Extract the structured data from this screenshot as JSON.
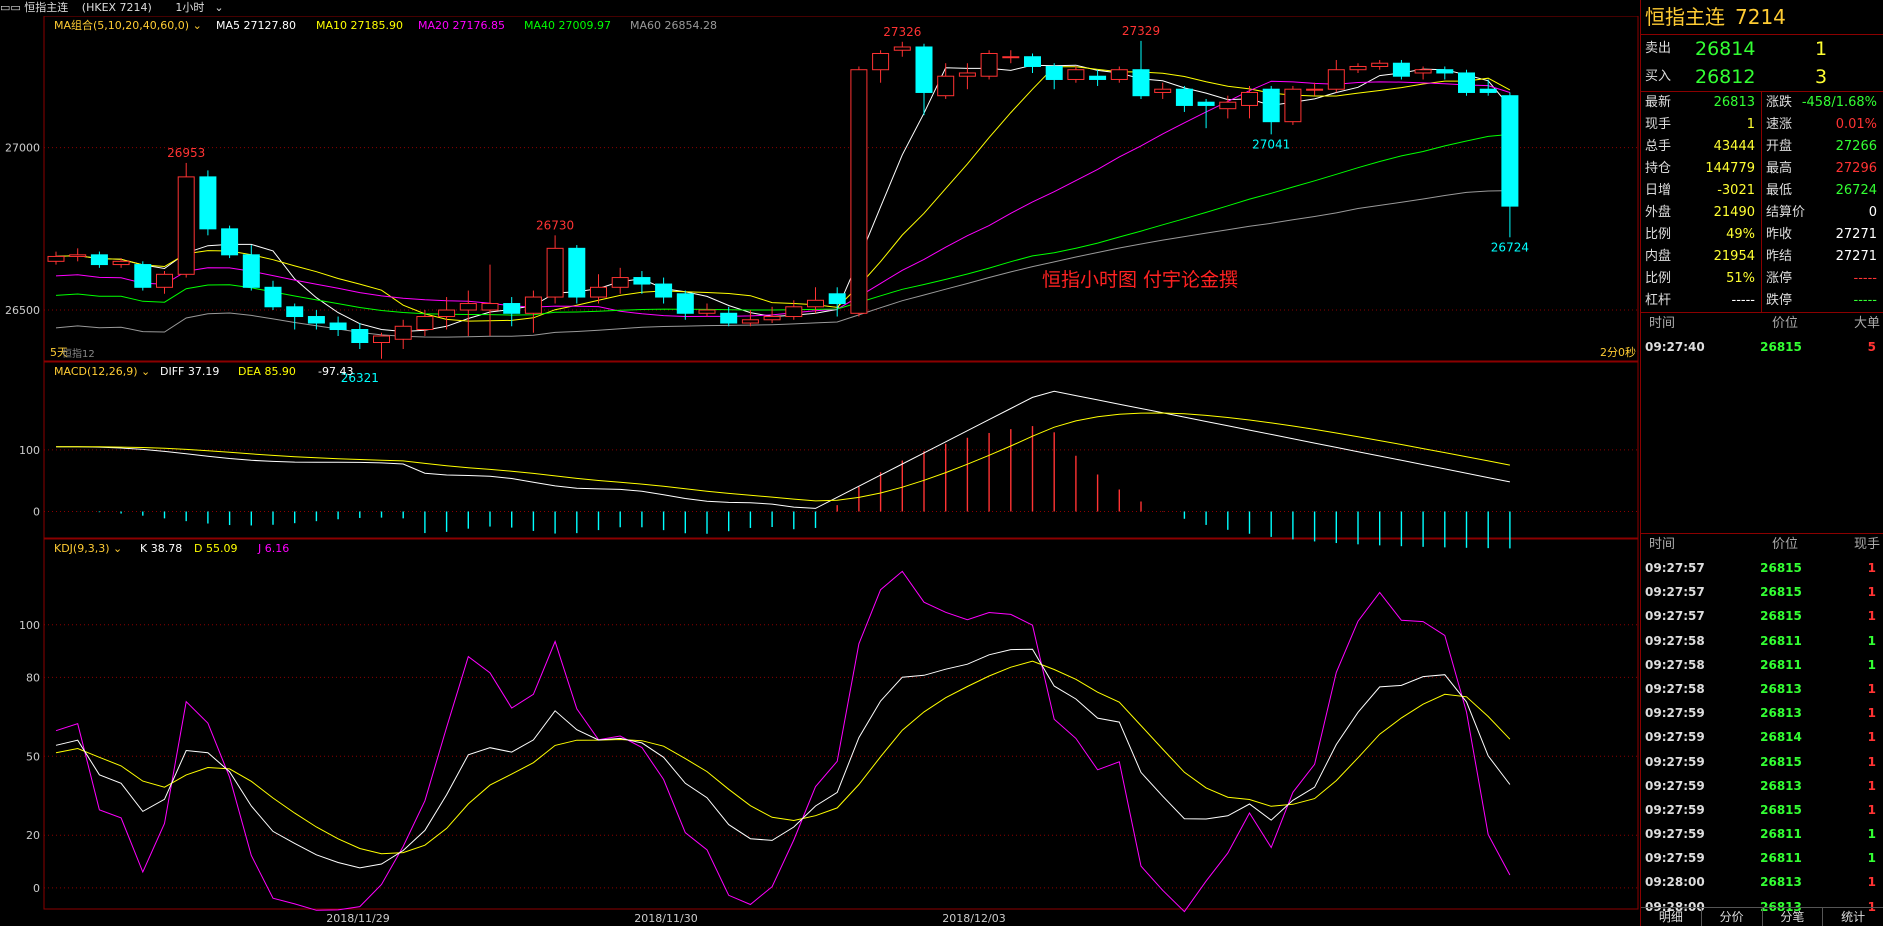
{
  "window": {
    "title": "恒指主连",
    "code": "(HKEX 7214)",
    "period": "1小时"
  },
  "panels": {
    "main": {
      "ma_label": "MA组合(5,10,20,40,60,0)",
      "ma_values": [
        {
          "label": "MA5 27127.80",
          "color": "#ffffff"
        },
        {
          "label": "MA10 27185.90",
          "color": "#ffff00"
        },
        {
          "label": "MA20 27176.85",
          "color": "#ff00ff"
        },
        {
          "label": "MA40 27009.97",
          "color": "#00ff00"
        },
        {
          "label": "MA60 26854.28",
          "color": "#999999"
        }
      ],
      "y_ticks": [
        "27000",
        "26500"
      ],
      "annotations": [
        "26953",
        "26730",
        "27326",
        "27329",
        "27041",
        "26724",
        "26321"
      ],
      "watermark": "恒指小时图  付宇论金撰",
      "left_corner": "5天",
      "left_corner2": "恒指12",
      "countdown": "2分0秒"
    },
    "macd": {
      "label": "MACD(12,26,9)",
      "diff": "DIFF 37.19",
      "dea": "DEA 85.90",
      "macd": "-97.43",
      "y_ticks": [
        "100",
        "0"
      ]
    },
    "kdj": {
      "label": "KDJ(9,3,3)",
      "k": "K 38.78",
      "d": "D 55.09",
      "j": "J 6.16",
      "y_ticks": [
        "100",
        "80",
        "50",
        "20",
        "0"
      ]
    },
    "x_dates": [
      "2018/11/29",
      "2018/11/30",
      "2018/12/03"
    ]
  },
  "chart_data": {
    "type": "candlestick",
    "candles": [
      [
        26650,
        26665,
        26640,
        26680
      ],
      [
        26665,
        26670,
        26650,
        26690
      ],
      [
        26670,
        26640,
        26630,
        26680
      ],
      [
        26640,
        26650,
        26630,
        26660
      ],
      [
        26640,
        26570,
        26560,
        26650
      ],
      [
        26570,
        26610,
        26550,
        26620
      ],
      [
        26610,
        26910,
        26600,
        26953
      ],
      [
        26910,
        26750,
        26730,
        26930
      ],
      [
        26750,
        26670,
        26660,
        26760
      ],
      [
        26670,
        26570,
        26560,
        26700
      ],
      [
        26570,
        26510,
        26500,
        26590
      ],
      [
        26510,
        26480,
        26440,
        26520
      ],
      [
        26480,
        26460,
        26440,
        26500
      ],
      [
        26460,
        26440,
        26420,
        26480
      ],
      [
        26440,
        26400,
        26380,
        26460
      ],
      [
        26400,
        26420,
        26350,
        26430
      ],
      [
        26410,
        26450,
        26380,
        26470
      ],
      [
        26440,
        26480,
        26420,
        26500
      ],
      [
        26480,
        26500,
        26440,
        26540
      ],
      [
        26500,
        26520,
        26420,
        26560
      ],
      [
        26500,
        26520,
        26420,
        26640
      ],
      [
        26520,
        26490,
        26450,
        26540
      ],
      [
        26490,
        26540,
        26430,
        26560
      ],
      [
        26540,
        26690,
        26520,
        26730
      ],
      [
        26690,
        26540,
        26520,
        26700
      ],
      [
        26540,
        26570,
        26520,
        26610
      ],
      [
        26570,
        26600,
        26550,
        26630
      ],
      [
        26600,
        26580,
        26550,
        26620
      ],
      [
        26580,
        26540,
        26520,
        26600
      ],
      [
        26550,
        26490,
        26470,
        26560
      ],
      [
        26490,
        26500,
        26480,
        26520
      ],
      [
        26490,
        26460,
        26450,
        26510
      ],
      [
        26460,
        26470,
        26450,
        26500
      ],
      [
        26470,
        26480,
        26460,
        26510
      ],
      [
        26480,
        26510,
        26470,
        26530
      ],
      [
        26510,
        26530,
        26490,
        26570
      ],
      [
        26550,
        26520,
        26480,
        26570
      ],
      [
        26490,
        27240,
        26480,
        27250
      ],
      [
        27240,
        27290,
        27200,
        27300
      ],
      [
        27300,
        27310,
        27280,
        27326
      ],
      [
        27310,
        27170,
        27100,
        27320
      ],
      [
        27160,
        27220,
        27150,
        27260
      ],
      [
        27220,
        27230,
        27180,
        27260
      ],
      [
        27220,
        27290,
        27210,
        27300
      ],
      [
        27280,
        27280,
        27260,
        27300
      ],
      [
        27280,
        27250,
        27230,
        27290
      ],
      [
        27250,
        27210,
        27180,
        27260
      ],
      [
        27210,
        27240,
        27200,
        27250
      ],
      [
        27220,
        27210,
        27190,
        27240
      ],
      [
        27210,
        27240,
        27200,
        27250
      ],
      [
        27240,
        27160,
        27150,
        27329
      ],
      [
        27170,
        27180,
        27150,
        27200
      ],
      [
        27180,
        27130,
        27110,
        27190
      ],
      [
        27140,
        27130,
        27060,
        27150
      ],
      [
        27120,
        27140,
        27090,
        27160
      ],
      [
        27130,
        27170,
        27090,
        27190
      ],
      [
        27180,
        27080,
        27041,
        27190
      ],
      [
        27080,
        27180,
        27070,
        27190
      ],
      [
        27180,
        27180,
        27160,
        27200
      ],
      [
        27180,
        27240,
        27170,
        27270
      ],
      [
        27240,
        27250,
        27230,
        27260
      ],
      [
        27250,
        27260,
        27240,
        27270
      ],
      [
        27260,
        27220,
        27210,
        27270
      ],
      [
        27230,
        27240,
        27210,
        27250
      ],
      [
        27240,
        27230,
        27210,
        27250
      ],
      [
        27230,
        27170,
        27160,
        27240
      ],
      [
        27180,
        27170,
        27160,
        27210
      ],
      [
        27160,
        26820,
        26724,
        27170
      ]
    ],
    "y_range": [
      26380,
      27350
    ],
    "macd_range": [
      -30,
      210
    ],
    "kdj_range": [
      -5,
      125
    ],
    "grid": true
  },
  "right_panel": {
    "title": "恒指主连",
    "code": "7214",
    "sell": {
      "label": "卖出",
      "price": "26814",
      "qty": "1"
    },
    "buy": {
      "label": "买入",
      "price": "26812",
      "qty": "3"
    },
    "stats": [
      [
        {
          "k": "最新",
          "v": "26813",
          "c": "#33ff33"
        },
        {
          "k": "涨跌",
          "v": "-458/1.68%",
          "c": "#33ff33"
        }
      ],
      [
        {
          "k": "现手",
          "v": "1",
          "c": "#ffff33"
        },
        {
          "k": "速涨",
          "v": "0.01%",
          "c": "#ff3333"
        }
      ],
      [
        {
          "k": "总手",
          "v": "43444",
          "c": "#ffff33"
        },
        {
          "k": "开盘",
          "v": "27266",
          "c": "#33ff33"
        }
      ],
      [
        {
          "k": "持仓",
          "v": "144779",
          "c": "#ffff33"
        },
        {
          "k": "最高",
          "v": "27296",
          "c": "#ff3333"
        }
      ],
      [
        {
          "k": "日增",
          "v": "-3021",
          "c": "#ffff33"
        },
        {
          "k": "最低",
          "v": "26724",
          "c": "#33ff33"
        }
      ],
      [
        {
          "k": "外盘",
          "v": "21490",
          "c": "#ffff33"
        },
        {
          "k": "结算价",
          "v": "0",
          "c": "#ffffff"
        }
      ],
      [
        {
          "k": "比例",
          "v": "49%",
          "c": "#ffff33"
        },
        {
          "k": "昨收",
          "v": "27271",
          "c": "#ffffff"
        }
      ],
      [
        {
          "k": "内盘",
          "v": "21954",
          "c": "#ffff33"
        },
        {
          "k": "昨结",
          "v": "27271",
          "c": "#ffffff"
        }
      ],
      [
        {
          "k": "比例",
          "v": "51%",
          "c": "#ffff33"
        },
        {
          "k": "涨停",
          "v": "-----",
          "c": "#ff3333"
        }
      ],
      [
        {
          "k": "杠杆",
          "v": "-----",
          "c": "#ffffff"
        },
        {
          "k": "跌停",
          "v": "-----",
          "c": "#33ff33"
        }
      ]
    ],
    "bigtrade_header": [
      "时间",
      "价位",
      "大单"
    ],
    "bigtrade": [
      {
        "time": "09:27:40",
        "price": "26815",
        "vol": "5"
      }
    ],
    "ticks_header": [
      "时间",
      "价位",
      "现手"
    ],
    "ticks": [
      {
        "time": "09:27:57",
        "price": "26815",
        "vol": "1",
        "c": "#ff3333"
      },
      {
        "time": "09:27:57",
        "price": "26815",
        "vol": "1",
        "c": "#ff3333"
      },
      {
        "time": "09:27:57",
        "price": "26815",
        "vol": "1",
        "c": "#ff3333"
      },
      {
        "time": "09:27:58",
        "price": "26811",
        "vol": "1",
        "c": "#33ff33"
      },
      {
        "time": "09:27:58",
        "price": "26811",
        "vol": "1",
        "c": "#33ff33"
      },
      {
        "time": "09:27:58",
        "price": "26813",
        "vol": "1",
        "c": "#ff3333"
      },
      {
        "time": "09:27:59",
        "price": "26813",
        "vol": "1",
        "c": "#ff3333"
      },
      {
        "time": "09:27:59",
        "price": "26814",
        "vol": "1",
        "c": "#ff3333"
      },
      {
        "time": "09:27:59",
        "price": "26815",
        "vol": "1",
        "c": "#ff3333"
      },
      {
        "time": "09:27:59",
        "price": "26813",
        "vol": "1",
        "c": "#ff3333"
      },
      {
        "time": "09:27:59",
        "price": "26815",
        "vol": "1",
        "c": "#ff3333"
      },
      {
        "time": "09:27:59",
        "price": "26811",
        "vol": "1",
        "c": "#33ff33"
      },
      {
        "time": "09:27:59",
        "price": "26811",
        "vol": "1",
        "c": "#33ff33"
      },
      {
        "time": "09:28:00",
        "price": "26813",
        "vol": "1",
        "c": "#ff3333"
      },
      {
        "time": "09:28:00",
        "price": "26813",
        "vol": "1",
        "c": "#ff3333"
      }
    ],
    "tabs": [
      "明细",
      "分价",
      "分笔",
      "统计"
    ]
  },
  "colors": {
    "up": "#ff3333",
    "down": "#00ffff",
    "grid": "#8b0000"
  }
}
